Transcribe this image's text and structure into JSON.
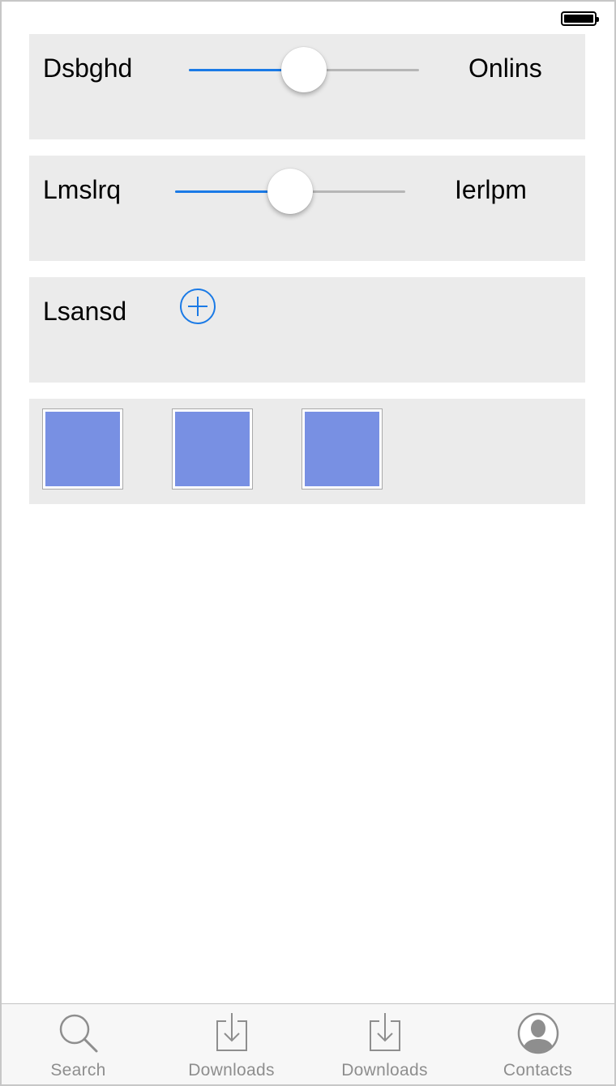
{
  "status_bar": {
    "battery_icon": "battery-full-icon",
    "battery_level": 1.0
  },
  "panels": [
    {
      "label": "Dsbghd",
      "right_label": "Onlins",
      "slider_value": 0.5
    },
    {
      "label": "Lmslrq",
      "right_label": "Ierlpm",
      "slider_value": 0.5
    },
    {
      "label": "Lsansd",
      "button_icon": "plus-circle-icon"
    }
  ],
  "swatches": [
    {
      "color": "#7890e3"
    },
    {
      "color": "#7890e3"
    },
    {
      "color": "#7890e3"
    }
  ],
  "tabbar": {
    "tabs": [
      {
        "label": "Search",
        "icon": "search-icon"
      },
      {
        "label": "Downloads",
        "icon": "download-icon"
      },
      {
        "label": "Downloads",
        "icon": "download-icon"
      },
      {
        "label": "Contacts",
        "icon": "contact-icon"
      }
    ]
  },
  "colors": {
    "accent": "#1a7ae6",
    "panel_bg": "#ebebeb",
    "tab_label": "#8e8e8e",
    "swatch_fill": "#7890e3"
  }
}
